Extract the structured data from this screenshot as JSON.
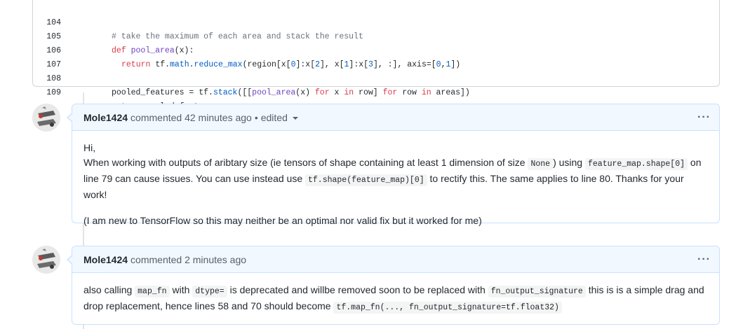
{
  "code": {
    "lines": [
      {
        "num": "104"
      },
      {
        "num": "105"
      },
      {
        "num": "106"
      },
      {
        "num": "107"
      },
      {
        "num": "108"
      },
      {
        "num": "109"
      }
    ],
    "tokens": {
      "l104_comment": "# take the maximum of each area and stack the result",
      "l105_def": "def",
      "l105_fn": "pool_area",
      "l105_rest": "(x):",
      "l106_return": "return",
      "l106_a": " tf.",
      "l106_b": "math",
      "l106_c": ".",
      "l106_d": "reduce_max",
      "l106_e": "(region[x[",
      "l106_f": "0",
      "l106_g": "]:x[",
      "l106_h": "2",
      "l106_i": "], x[",
      "l106_j": "1",
      "l106_k": "]:x[",
      "l106_l": "3",
      "l106_m": "], :], axis=[",
      "l106_n": "0",
      "l106_o": ",",
      "l106_p": "1",
      "l106_q": "])",
      "l108_a": "pooled_features = tf.",
      "l108_b": "stack",
      "l108_c": "([[",
      "l108_d": "pool_area",
      "l108_e": "(x) ",
      "l108_f": "for",
      "l108_g": " x ",
      "l108_h": "in",
      "l108_i": " row] ",
      "l108_j": "for",
      "l108_k": " row ",
      "l108_l": "in",
      "l108_m": " areas])",
      "l109_return": "return",
      "l109_rest": " pooled_features"
    }
  },
  "comments": [
    {
      "author": "Mole1424",
      "action": "commented",
      "time": "42 minutes ago",
      "separator": "•",
      "edited": "edited",
      "menu": "···",
      "body": {
        "p1": "Hi,",
        "p2_a": "When working with outputs of aribtary size (ie tensors of shape containing at least 1 dimension of size ",
        "p2_code1": "None",
        "p2_b": ") using ",
        "p2_code2": "feature_map.shape[0]",
        "p2_c": " on line 79 can cause issues. You can use instead use ",
        "p2_code3": "tf.shape(feature_map)[0]",
        "p2_d": " to rectify this. The same applies to line 80. Thanks for your work!",
        "p3": "(I am new to TensorFlow so this may neither be an optimal nor valid fix but it worked for me)"
      }
    },
    {
      "author": "Mole1424",
      "action": "commented",
      "time": "2 minutes ago",
      "menu": "···",
      "body": {
        "a": "also calling ",
        "code1": "map_fn",
        "b": " with ",
        "code2": "dtype=",
        "c": " is deprecated and willbe removed soon to be replaced with ",
        "code3": "fn_output_signature",
        "d": " this is is a simple drag and drop replacement, hence lines 58 and 70 should become ",
        "code4": "tf.map_fn(..., fn_output_signature=tf.float32)"
      }
    }
  ]
}
